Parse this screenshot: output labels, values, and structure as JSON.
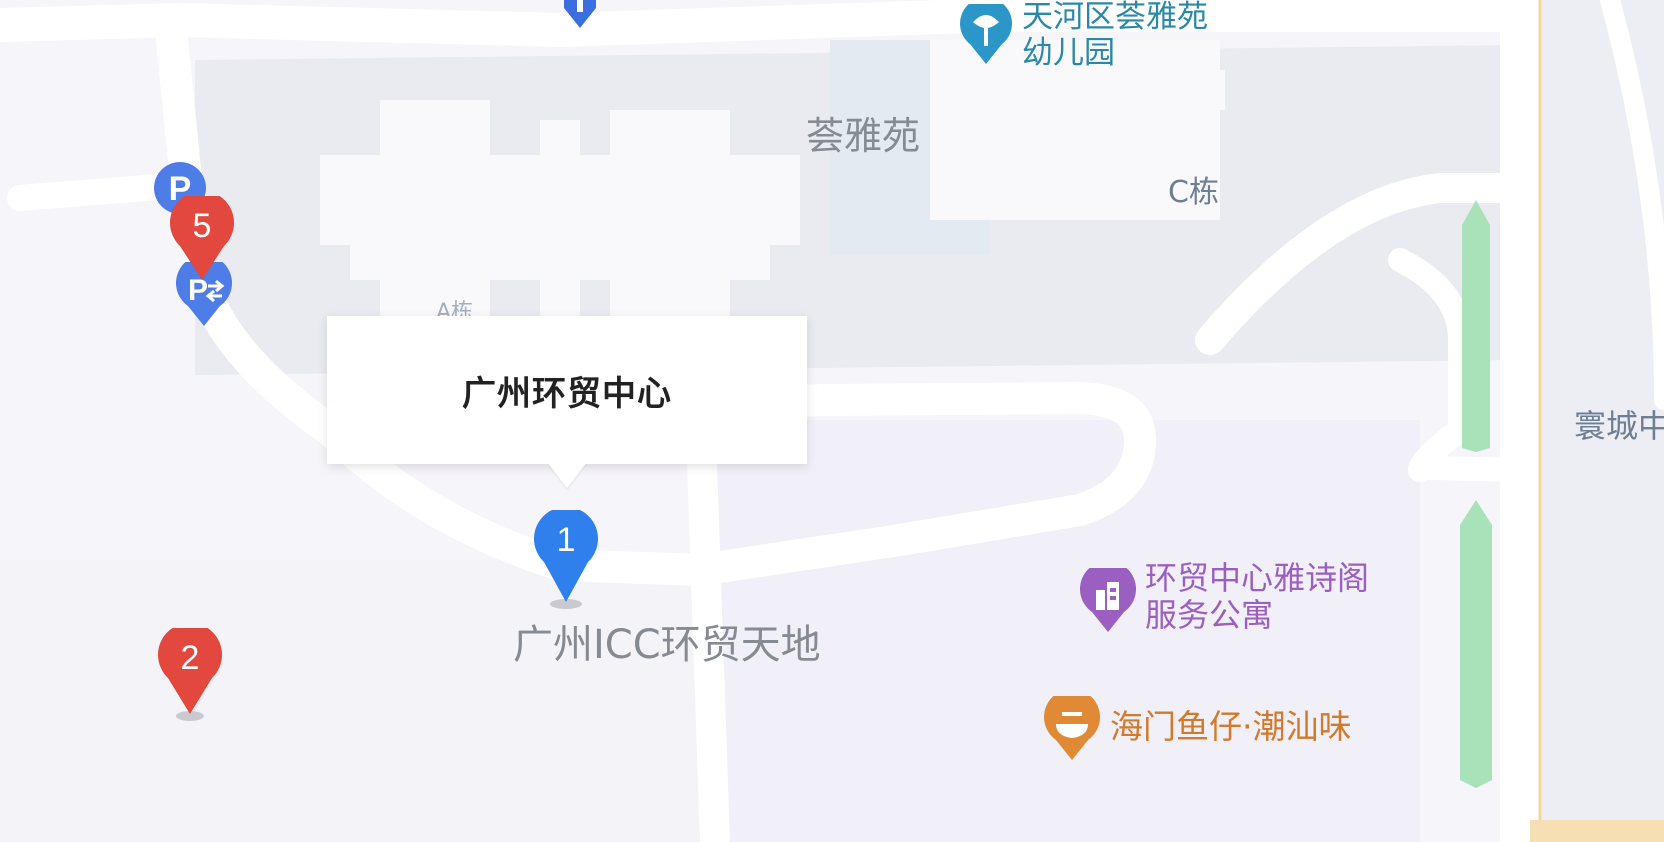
{
  "popup": {
    "title": "广州环贸中心"
  },
  "labels": {
    "kindergarten": [
      "天河区荟雅苑",
      "幼儿园"
    ],
    "community": "荟雅苑",
    "building_c": "C栋",
    "building_a": "A栋",
    "tiancheng": "寰城中",
    "icc": "广州ICC环贸天地",
    "apartment": [
      "环贸中心雅诗阁",
      "服务公寓"
    ],
    "restaurant": "海门鱼仔·潮汕味"
  },
  "markers": [
    {
      "label": "1",
      "color": "#2f80ed"
    },
    {
      "label": "2",
      "color": "#e2483d"
    },
    {
      "label": "5",
      "color": "#e2483d"
    }
  ],
  "icons": {
    "parking": "P",
    "parking_transfer": "P⇄",
    "kindergarten": "kindergarten-icon",
    "apartment": "hotel-building-icon",
    "restaurant": "restaurant-icon"
  },
  "colors": {
    "background": "#f6f5fa",
    "block": "#e9ebf0",
    "road": "#ffffff",
    "green": "#a9e2b8",
    "blue_marker": "#2f80ed",
    "red_marker": "#e2483d",
    "poi_purple": "#9a5fc0",
    "poi_orange": "#e08a36",
    "poi_teal": "#2a97c8"
  }
}
